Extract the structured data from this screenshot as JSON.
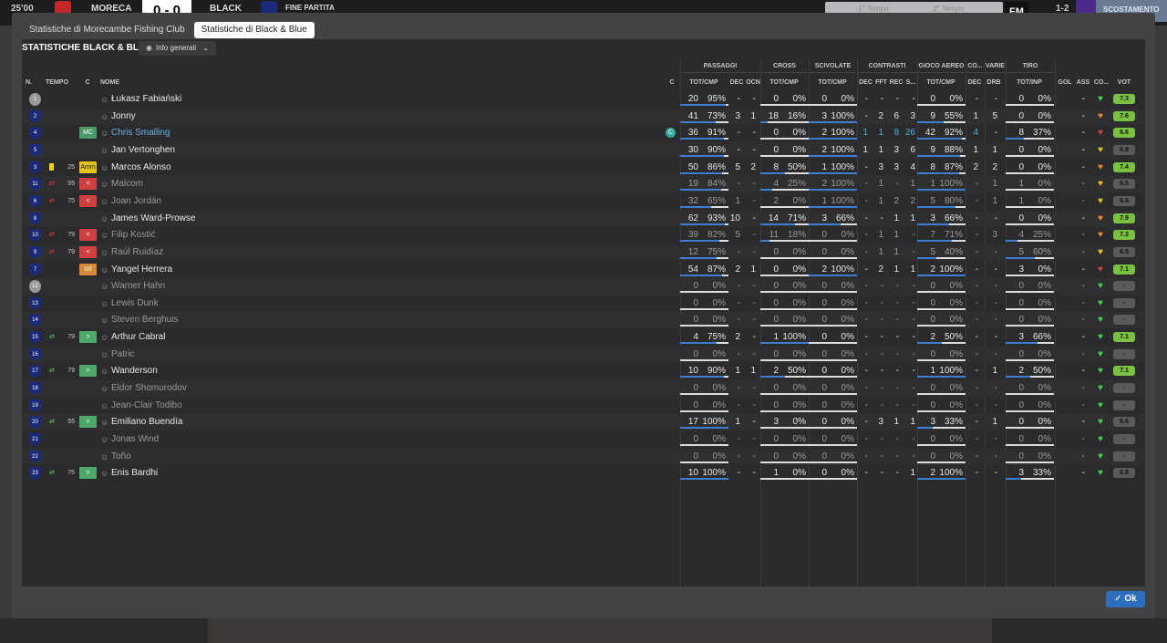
{
  "topbar": {
    "left_time": "25'00",
    "home": "MORECA",
    "score": "0 - 0",
    "away": "BLACK",
    "status": "FINE PARTITA",
    "time1": "1° Tempo",
    "time2": "2° Tempo",
    "fm": "FM",
    "result_hint": "1-2",
    "skip": "SCOSTAMENTO"
  },
  "tabs": [
    "Statistiche di Morecambe Fishing Club",
    "Statistiche di Black & Blue"
  ],
  "active_tab": 1,
  "panel_title": "STATISTICHE BLACK & BLUE",
  "dropdown_label": "Info generali",
  "headers": {
    "groups": {
      "passaggi": "PASSAGGI",
      "cross": "CROSS",
      "scivolate": "SCIVOLATE",
      "contrasti": "CONTRASTI",
      "gioco_aereo": "GIOCO AEREO",
      "co": "CO...",
      "varie": "VARIE",
      "tiro": "TIRO"
    },
    "n": "N.",
    "tempo": "TEMPO",
    "c": "C",
    "nome": "NOME",
    "c2": "C",
    "pass_tot": "TOT/CMP",
    "pass_dec": "DEC",
    "pass_ocn": "OCN",
    "cross_tot": "TOT/CMP",
    "sciv_tot": "TOT/CMP",
    "con_dec": "DEC",
    "con_fft": "FFT",
    "con_rec": "REC",
    "con_s": "S...",
    "aer_tot": "TOT/CMP",
    "co_dec": "DEC",
    "drb": "DRB",
    "tiro_tot": "TOT/INP",
    "gol": "GOL",
    "ass": "ASS",
    "co2": "CO...",
    "vot": "VOT"
  },
  "colors": {
    "rating_green": "#7ac142",
    "rating_gold": "#b5cc26",
    "rating_grey": "#5a5a5d",
    "heart_green": "#3ecf4e",
    "heart_yellow": "#e6c21c",
    "heart_orange": "#e6882a",
    "heart_red": "#d04040",
    "bar_blue": "#3c7fd1"
  },
  "players": [
    {
      "n": "1",
      "gk": true,
      "card": false,
      "sub": "",
      "min": "",
      "pos": "",
      "pos_color": "",
      "name": "Łukasz Fabiański",
      "style": "",
      "cap": "",
      "pt": "20",
      "pp": "95%",
      "dec": "-",
      "ocn": "-",
      "ct": "0",
      "cp": "0%",
      "st": "0",
      "sp": "0%",
      "cd": "-",
      "cf": "-",
      "cr": "-",
      "cs": "-",
      "at": "0",
      "ap": "0%",
      "cod": "-",
      "drb": "-",
      "tt": "0",
      "tp": "0%",
      "gol": "",
      "ass": "-",
      "heart": "green",
      "vot": "7.3",
      "vcol": "rating_green",
      "pf": 0.95,
      "cf2": 0,
      "sf": 0,
      "af": 0,
      "tf": 0
    },
    {
      "n": "2",
      "gk": false,
      "card": false,
      "sub": "",
      "min": "",
      "pos": "",
      "pos_color": "",
      "name": "Jonny",
      "style": "",
      "cap": "",
      "pt": "41",
      "pp": "73%",
      "dec": "3",
      "ocn": "1",
      "ct": "18",
      "cp": "16%",
      "st": "3",
      "sp": "100%",
      "cd": "-",
      "cf": "2",
      "cr": "6",
      "cs": "3",
      "at": "9",
      "ap": "55%",
      "cod": "1",
      "drb": "5",
      "tt": "0",
      "tp": "0%",
      "gol": "",
      "ass": "-",
      "heart": "orange",
      "vot": "7.6",
      "vcol": "rating_green",
      "pf": 0.73,
      "cf2": 0.16,
      "sf": 1,
      "af": 0.55,
      "tf": 0
    },
    {
      "n": "4",
      "gk": false,
      "card": false,
      "sub": "",
      "min": "",
      "pos": "MC",
      "pos_color": "#4a9a6a",
      "name": "Chris Smalling",
      "style": "link",
      "cap": "C",
      "pt": "36",
      "pp": "91%",
      "dec": "-",
      "ocn": "-",
      "ct": "0",
      "cp": "0%",
      "st": "2",
      "sp": "100%",
      "cd": "1",
      "cf": "1",
      "cr": "8",
      "cs": "26",
      "at": "42",
      "ap": "92%",
      "cod": "4",
      "drb": "-",
      "tt": "8",
      "tp": "37%",
      "gol": "",
      "ass": "-",
      "heart": "red",
      "vot": "8.6",
      "vcol": "rating_green",
      "pf": 0.91,
      "cf2": 0,
      "sf": 1,
      "af": 0.92,
      "tf": 0.37,
      "hl": true
    },
    {
      "n": "5",
      "gk": false,
      "card": false,
      "sub": "",
      "min": "",
      "pos": "",
      "pos_color": "",
      "name": "Jan Vertonghen",
      "style": "",
      "cap": "",
      "pt": "30",
      "pp": "90%",
      "dec": "-",
      "ocn": "-",
      "ct": "0",
      "cp": "0%",
      "st": "2",
      "sp": "100%",
      "cd": "1",
      "cf": "1",
      "cr": "3",
      "cs": "6",
      "at": "9",
      "ap": "88%",
      "cod": "1",
      "drb": "1",
      "tt": "0",
      "tp": "0%",
      "gol": "",
      "ass": "-",
      "heart": "yellow",
      "vot": "6.8",
      "vcol": "rating_grey",
      "pf": 0.9,
      "cf2": 0,
      "sf": 1,
      "af": 0.88,
      "tf": 0
    },
    {
      "n": "3",
      "gk": false,
      "card": true,
      "sub": "",
      "min": "25",
      "pos": "Amm",
      "pos_color": "#e6c21c",
      "name": "Marcos Alonso",
      "style": "",
      "cap": "",
      "pt": "50",
      "pp": "86%",
      "dec": "5",
      "ocn": "2",
      "ct": "8",
      "cp": "50%",
      "st": "1",
      "sp": "100%",
      "cd": "-",
      "cf": "3",
      "cr": "3",
      "cs": "4",
      "at": "8",
      "ap": "87%",
      "cod": "2",
      "drb": "2",
      "tt": "0",
      "tp": "0%",
      "gol": "",
      "ass": "-",
      "heart": "orange",
      "vot": "7.4",
      "vcol": "rating_green",
      "pf": 0.86,
      "cf2": 0.5,
      "sf": 1,
      "af": 0.87,
      "tf": 0
    },
    {
      "n": "11",
      "gk": false,
      "card": false,
      "sub": "off",
      "min": "55",
      "pos": "<",
      "pos_color": "#d04040",
      "name": "Malcom",
      "style": "dim",
      "cap": "",
      "pt": "19",
      "pp": "84%",
      "dec": "-",
      "ocn": "-",
      "ct": "4",
      "cp": "25%",
      "st": "2",
      "sp": "100%",
      "cd": "-",
      "cf": "1",
      "cr": "-",
      "cs": "1",
      "at": "1",
      "ap": "100%",
      "cod": "-",
      "drb": "1",
      "tt": "1",
      "tp": "0%",
      "gol": "",
      "ass": "-",
      "heart": "yellow",
      "vot": "6.5",
      "vcol": "rating_grey",
      "pf": 0.84,
      "cf2": 0.25,
      "sf": 1,
      "af": 1,
      "tf": 0,
      "dim": true
    },
    {
      "n": "6",
      "gk": false,
      "card": false,
      "sub": "off",
      "min": "75",
      "pos": "<",
      "pos_color": "#d04040",
      "name": "Joan Jordán",
      "style": "dim",
      "cap": "",
      "pt": "32",
      "pp": "65%",
      "dec": "1",
      "ocn": "-",
      "ct": "2",
      "cp": "0%",
      "st": "1",
      "sp": "100%",
      "cd": "-",
      "cf": "1",
      "cr": "2",
      "cs": "2",
      "at": "5",
      "ap": "80%",
      "cod": "-",
      "drb": "1",
      "tt": "1",
      "tp": "0%",
      "gol": "",
      "ass": "-",
      "heart": "yellow",
      "vot": "6.6",
      "vcol": "rating_grey",
      "pf": 0.65,
      "cf2": 0,
      "sf": 1,
      "af": 0.8,
      "tf": 0,
      "dim": true
    },
    {
      "n": "8",
      "gk": false,
      "card": false,
      "sub": "",
      "min": "",
      "pos": "",
      "pos_color": "",
      "name": "James Ward-Prowse",
      "style": "",
      "cap": "",
      "pt": "62",
      "pp": "93%",
      "dec": "10",
      "ocn": "-",
      "ct": "14",
      "cp": "71%",
      "st": "3",
      "sp": "66%",
      "cd": "-",
      "cf": "-",
      "cr": "1",
      "cs": "1",
      "at": "3",
      "ap": "66%",
      "cod": "-",
      "drb": "-",
      "tt": "0",
      "tp": "0%",
      "gol": "",
      "ass": "-",
      "heart": "orange",
      "vot": "7.9",
      "vcol": "rating_green",
      "pf": 0.93,
      "cf2": 0.71,
      "sf": 0.66,
      "af": 0.66,
      "tf": 0
    },
    {
      "n": "10",
      "gk": false,
      "card": false,
      "sub": "off",
      "min": "79",
      "pos": "<",
      "pos_color": "#d04040",
      "name": "Filip Kostić",
      "style": "dim",
      "cap": "",
      "pt": "39",
      "pp": "82%",
      "dec": "5",
      "ocn": "-",
      "ct": "11",
      "cp": "18%",
      "st": "0",
      "sp": "0%",
      "cd": "-",
      "cf": "1",
      "cr": "1",
      "cs": "-",
      "at": "7",
      "ap": "71%",
      "cod": "-",
      "drb": "3",
      "tt": "4",
      "tp": "25%",
      "gol": "",
      "ass": "-",
      "heart": "orange",
      "vot": "7.3",
      "vcol": "rating_green",
      "pf": 0.82,
      "cf2": 0.18,
      "sf": 0,
      "af": 0.71,
      "tf": 0.25,
      "dim": true
    },
    {
      "n": "9",
      "gk": false,
      "card": false,
      "sub": "off",
      "min": "79",
      "pos": "<",
      "pos_color": "#d04040",
      "name": "Raúl Ruidíaz",
      "style": "dim",
      "cap": "",
      "pt": "12",
      "pp": "75%",
      "dec": "-",
      "ocn": "-",
      "ct": "0",
      "cp": "0%",
      "st": "0",
      "sp": "0%",
      "cd": "-",
      "cf": "1",
      "cr": "1",
      "cs": "-",
      "at": "5",
      "ap": "40%",
      "cod": "-",
      "drb": "-",
      "tt": "5",
      "tp": "60%",
      "gol": "",
      "ass": "-",
      "heart": "yellow",
      "vot": "6.5",
      "vcol": "rating_grey",
      "pf": 0.75,
      "cf2": 0,
      "sf": 0,
      "af": 0.4,
      "tf": 0.6,
      "dim": true
    },
    {
      "n": "7",
      "gk": false,
      "card": false,
      "sub": "",
      "min": "",
      "pos": "Inf",
      "pos_color": "#d88a3a",
      "name": "Yangel Herrera",
      "style": "",
      "cap": "",
      "pt": "54",
      "pp": "87%",
      "dec": "2",
      "ocn": "1",
      "ct": "0",
      "cp": "0%",
      "st": "2",
      "sp": "100%",
      "cd": "-",
      "cf": "2",
      "cr": "1",
      "cs": "1",
      "at": "2",
      "ap": "100%",
      "cod": "-",
      "drb": "-",
      "tt": "3",
      "tp": "0%",
      "gol": "",
      "ass": "-",
      "heart": "red",
      "vot": "7.1",
      "vcol": "rating_green",
      "pf": 0.87,
      "cf2": 0,
      "sf": 1,
      "af": 1,
      "tf": 0
    },
    {
      "n": "12",
      "gk": true,
      "card": false,
      "sub": "",
      "min": "",
      "pos": "",
      "pos_color": "",
      "name": "Warner Hahn",
      "style": "dim",
      "cap": "",
      "pt": "0",
      "pp": "0%",
      "dec": "-",
      "ocn": "-",
      "ct": "0",
      "cp": "0%",
      "st": "0",
      "sp": "0%",
      "cd": "-",
      "cf": "-",
      "cr": "-",
      "cs": "-",
      "at": "0",
      "ap": "0%",
      "cod": "-",
      "drb": "-",
      "tt": "0",
      "tp": "0%",
      "gol": "",
      "ass": "-",
      "heart": "green",
      "vot": "-",
      "vcol": "rating_grey",
      "pf": 0,
      "cf2": 0,
      "sf": 0,
      "af": 0,
      "tf": 0,
      "dim": true
    },
    {
      "n": "13",
      "gk": false,
      "card": false,
      "sub": "",
      "min": "",
      "pos": "",
      "pos_color": "",
      "name": "Lewis Dunk",
      "style": "dim",
      "cap": "",
      "pt": "0",
      "pp": "0%",
      "dec": "-",
      "ocn": "-",
      "ct": "0",
      "cp": "0%",
      "st": "0",
      "sp": "0%",
      "cd": "-",
      "cf": "-",
      "cr": "-",
      "cs": "-",
      "at": "0",
      "ap": "0%",
      "cod": "-",
      "drb": "-",
      "tt": "0",
      "tp": "0%",
      "gol": "",
      "ass": "-",
      "heart": "green",
      "vot": "-",
      "vcol": "rating_grey",
      "pf": 0,
      "cf2": 0,
      "sf": 0,
      "af": 0,
      "tf": 0,
      "dim": true
    },
    {
      "n": "14",
      "gk": false,
      "card": false,
      "sub": "",
      "min": "",
      "pos": "",
      "pos_color": "",
      "name": "Steven Berghuis",
      "style": "dim",
      "cap": "",
      "pt": "0",
      "pp": "0%",
      "dec": "-",
      "ocn": "-",
      "ct": "0",
      "cp": "0%",
      "st": "0",
      "sp": "0%",
      "cd": "-",
      "cf": "-",
      "cr": "-",
      "cs": "-",
      "at": "0",
      "ap": "0%",
      "cod": "-",
      "drb": "-",
      "tt": "0",
      "tp": "0%",
      "gol": "",
      "ass": "-",
      "heart": "green",
      "vot": "-",
      "vcol": "rating_grey",
      "pf": 0,
      "cf2": 0,
      "sf": 0,
      "af": 0,
      "tf": 0,
      "dim": true
    },
    {
      "n": "15",
      "gk": false,
      "card": false,
      "sub": "on",
      "min": "79",
      "pos": ">",
      "pos_color": "#4ea86a",
      "name": "Arthur Cabral",
      "style": "",
      "cap": "",
      "pt": "4",
      "pp": "75%",
      "dec": "2",
      "ocn": "-",
      "ct": "1",
      "cp": "100%",
      "st": "0",
      "sp": "0%",
      "cd": "-",
      "cf": "-",
      "cr": "-",
      "cs": "-",
      "at": "2",
      "ap": "50%",
      "cod": "-",
      "drb": "-",
      "tt": "3",
      "tp": "66%",
      "gol": "",
      "ass": "-",
      "heart": "green",
      "vot": "7.1",
      "vcol": "rating_green",
      "pf": 0.75,
      "cf2": 1,
      "sf": 0,
      "af": 0.5,
      "tf": 0.66
    },
    {
      "n": "16",
      "gk": false,
      "card": false,
      "sub": "",
      "min": "",
      "pos": "",
      "pos_color": "",
      "name": "Patric",
      "style": "dim",
      "cap": "",
      "pt": "0",
      "pp": "0%",
      "dec": "-",
      "ocn": "-",
      "ct": "0",
      "cp": "0%",
      "st": "0",
      "sp": "0%",
      "cd": "-",
      "cf": "-",
      "cr": "-",
      "cs": "-",
      "at": "0",
      "ap": "0%",
      "cod": "-",
      "drb": "-",
      "tt": "0",
      "tp": "0%",
      "gol": "",
      "ass": "-",
      "heart": "green",
      "vot": "-",
      "vcol": "rating_grey",
      "pf": 0,
      "cf2": 0,
      "sf": 0,
      "af": 0,
      "tf": 0,
      "dim": true
    },
    {
      "n": "17",
      "gk": false,
      "card": false,
      "sub": "on",
      "min": "79",
      "pos": ">",
      "pos_color": "#4ea86a",
      "name": "Wanderson",
      "style": "",
      "cap": "",
      "pt": "10",
      "pp": "90%",
      "dec": "1",
      "ocn": "1",
      "ct": "2",
      "cp": "50%",
      "st": "0",
      "sp": "0%",
      "cd": "-",
      "cf": "-",
      "cr": "-",
      "cs": "-",
      "at": "1",
      "ap": "100%",
      "cod": "-",
      "drb": "1",
      "tt": "2",
      "tp": "50%",
      "gol": "",
      "ass": "-",
      "heart": "green",
      "vot": "7.1",
      "vcol": "rating_green",
      "pf": 0.9,
      "cf2": 0.5,
      "sf": 0,
      "af": 1,
      "tf": 0.5
    },
    {
      "n": "18",
      "gk": false,
      "card": false,
      "sub": "",
      "min": "",
      "pos": "",
      "pos_color": "",
      "name": "Eldor Shomurodov",
      "style": "dim",
      "cap": "",
      "pt": "0",
      "pp": "0%",
      "dec": "-",
      "ocn": "-",
      "ct": "0",
      "cp": "0%",
      "st": "0",
      "sp": "0%",
      "cd": "-",
      "cf": "-",
      "cr": "-",
      "cs": "-",
      "at": "0",
      "ap": "0%",
      "cod": "-",
      "drb": "-",
      "tt": "0",
      "tp": "0%",
      "gol": "",
      "ass": "-",
      "heart": "green",
      "vot": "-",
      "vcol": "rating_grey",
      "pf": 0,
      "cf2": 0,
      "sf": 0,
      "af": 0,
      "tf": 0,
      "dim": true
    },
    {
      "n": "19",
      "gk": false,
      "card": false,
      "sub": "",
      "min": "",
      "pos": "",
      "pos_color": "",
      "name": "Jean-Clair Todibo",
      "style": "dim",
      "cap": "",
      "pt": "0",
      "pp": "0%",
      "dec": "-",
      "ocn": "-",
      "ct": "0",
      "cp": "0%",
      "st": "0",
      "sp": "0%",
      "cd": "-",
      "cf": "-",
      "cr": "-",
      "cs": "-",
      "at": "0",
      "ap": "0%",
      "cod": "-",
      "drb": "-",
      "tt": "0",
      "tp": "0%",
      "gol": "",
      "ass": "-",
      "heart": "green",
      "vot": "-",
      "vcol": "rating_grey",
      "pf": 0,
      "cf2": 0,
      "sf": 0,
      "af": 0,
      "tf": 0,
      "dim": true
    },
    {
      "n": "20",
      "gk": false,
      "card": false,
      "sub": "on",
      "min": "55",
      "pos": ">",
      "pos_color": "#4ea86a",
      "name": "Emiliano Buendía",
      "style": "",
      "cap": "",
      "pt": "17",
      "pp": "100%",
      "dec": "1",
      "ocn": "-",
      "ct": "3",
      "cp": "0%",
      "st": "0",
      "sp": "0%",
      "cd": "-",
      "cf": "3",
      "cr": "1",
      "cs": "1",
      "at": "3",
      "ap": "33%",
      "cod": "-",
      "drb": "1",
      "tt": "0",
      "tp": "0%",
      "gol": "",
      "ass": "-",
      "heart": "green",
      "vot": "6.6",
      "vcol": "rating_grey",
      "pf": 1,
      "cf2": 0,
      "sf": 0,
      "af": 0.33,
      "tf": 0
    },
    {
      "n": "21",
      "gk": false,
      "card": false,
      "sub": "",
      "min": "",
      "pos": "",
      "pos_color": "",
      "name": "Jonas Wind",
      "style": "dim",
      "cap": "",
      "pt": "0",
      "pp": "0%",
      "dec": "-",
      "ocn": "-",
      "ct": "0",
      "cp": "0%",
      "st": "0",
      "sp": "0%",
      "cd": "-",
      "cf": "-",
      "cr": "-",
      "cs": "-",
      "at": "0",
      "ap": "0%",
      "cod": "-",
      "drb": "-",
      "tt": "0",
      "tp": "0%",
      "gol": "",
      "ass": "-",
      "heart": "green",
      "vot": "-",
      "vcol": "rating_grey",
      "pf": 0,
      "cf2": 0,
      "sf": 0,
      "af": 0,
      "tf": 0,
      "dim": true
    },
    {
      "n": "22",
      "gk": false,
      "card": false,
      "sub": "",
      "min": "",
      "pos": "",
      "pos_color": "",
      "name": "Toño",
      "style": "dim",
      "cap": "",
      "pt": "0",
      "pp": "0%",
      "dec": "-",
      "ocn": "-",
      "ct": "0",
      "cp": "0%",
      "st": "0",
      "sp": "0%",
      "cd": "-",
      "cf": "-",
      "cr": "-",
      "cs": "-",
      "at": "0",
      "ap": "0%",
      "cod": "-",
      "drb": "-",
      "tt": "0",
      "tp": "0%",
      "gol": "",
      "ass": "-",
      "heart": "green",
      "vot": "-",
      "vcol": "rating_grey",
      "pf": 0,
      "cf2": 0,
      "sf": 0,
      "af": 0,
      "tf": 0,
      "dim": true
    },
    {
      "n": "23",
      "gk": false,
      "card": false,
      "sub": "on",
      "min": "75",
      "pos": ">",
      "pos_color": "#4ea86a",
      "name": "Enis Bardhi",
      "style": "",
      "cap": "",
      "pt": "10",
      "pp": "100%",
      "dec": "-",
      "ocn": "-",
      "ct": "1",
      "cp": "0%",
      "st": "0",
      "sp": "0%",
      "cd": "-",
      "cf": "-",
      "cr": "-",
      "cs": "1",
      "at": "2",
      "ap": "100%",
      "cod": "-",
      "drb": "-",
      "tt": "3",
      "tp": "33%",
      "gol": "",
      "ass": "-",
      "heart": "green",
      "vot": "6.8",
      "vcol": "rating_grey",
      "pf": 1,
      "cf2": 0,
      "sf": 0,
      "af": 1,
      "tf": 0.33
    }
  ],
  "ok_label": "Ok"
}
